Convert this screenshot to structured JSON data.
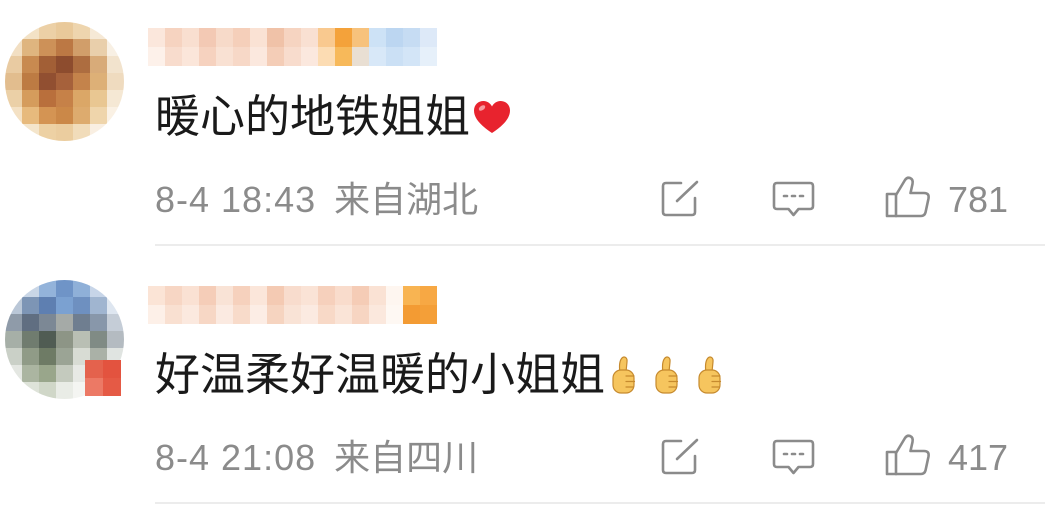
{
  "comments": [
    {
      "text": "暖心的地铁姐姐",
      "emojis": [
        "red-heart-emoji"
      ],
      "time": "8-4 18:43",
      "location": "来自湖北",
      "likes": 781
    },
    {
      "text": "好温柔好温暖的小姐姐",
      "emojis": [
        "thumbs-up-emoji",
        "thumbs-up-emoji",
        "thumbs-up-emoji"
      ],
      "time": "8-4 21:08",
      "location": "来自四川",
      "likes": 417
    }
  ],
  "actions": {
    "share_icon": "share-icon",
    "comment_icon": "comment-icon",
    "like_icon": "like-icon"
  },
  "colors": {
    "background": "#ffffff",
    "comment_text": "#1a1a1a",
    "meta_text": "#8b8b8b",
    "icon": "#8b8b8b",
    "divider": "#ececec",
    "heart": "#e8232e",
    "thumbs_up": "#f6c55e"
  }
}
